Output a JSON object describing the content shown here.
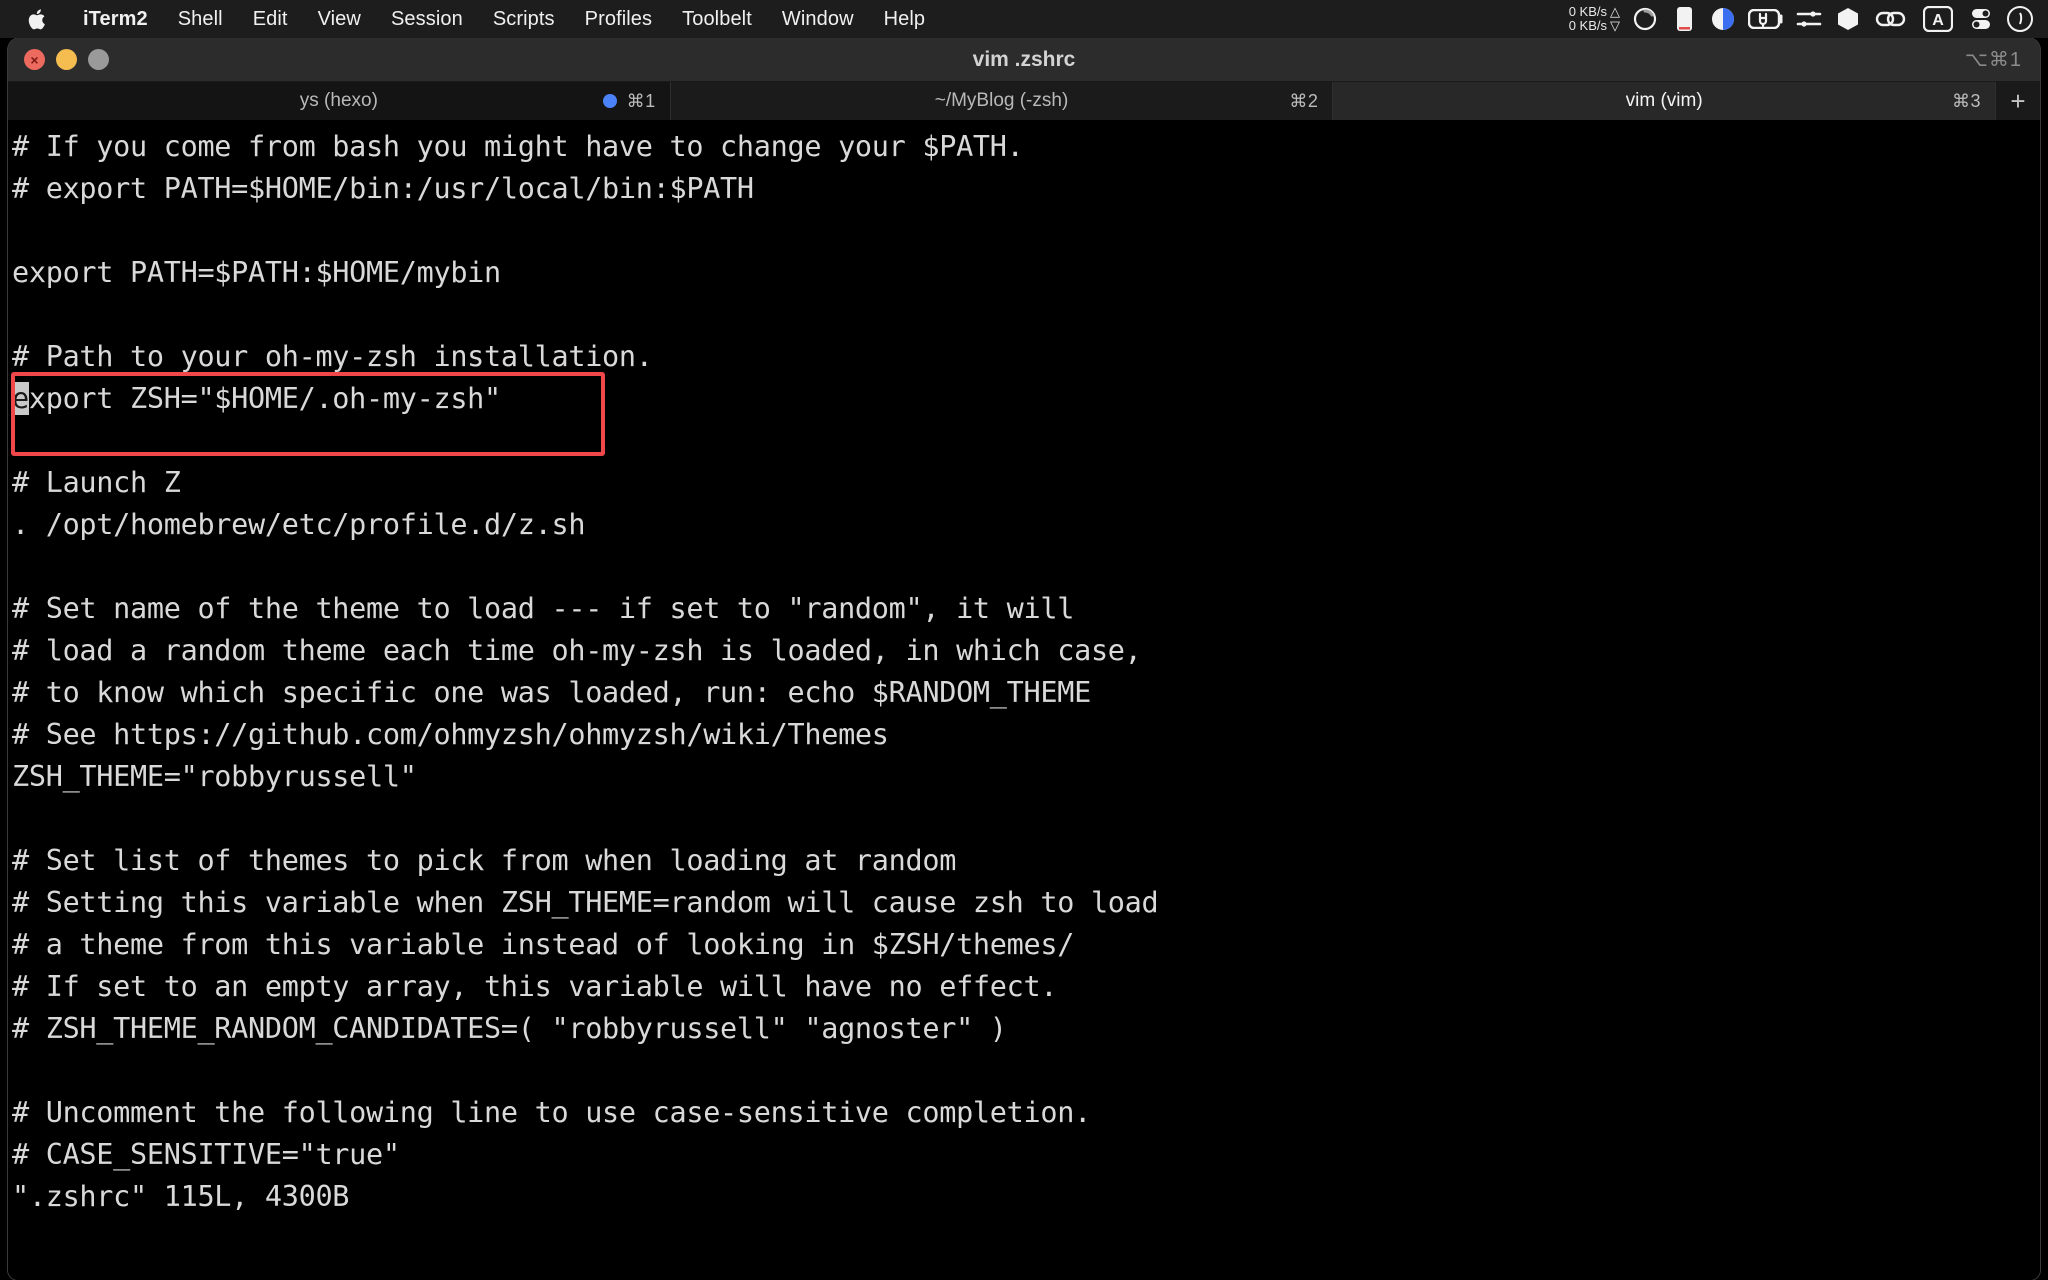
{
  "menubar": {
    "apple_icon": "apple-logo-icon",
    "items": [
      "iTerm2",
      "Shell",
      "Edit",
      "View",
      "Session",
      "Scripts",
      "Profiles",
      "Toolbelt",
      "Window",
      "Help"
    ],
    "status": {
      "upload_speed": "0 KB/s",
      "download_speed": "0 KB/s",
      "upload_arrow": "△",
      "download_arrow": "▽",
      "icons": [
        "activity-monitor-icon",
        "display-brightness-icon",
        "battery-charging-icon",
        "control-sliders-icon",
        "dropbox-icon",
        "link-icon",
        "input-method-a-icon",
        "toggle-switch-icon",
        "control-center-icon"
      ]
    }
  },
  "window": {
    "title": "vim .zshrc",
    "shortcut": "⌥⌘1",
    "traffic_lights": {
      "close": "close-button",
      "minimize": "minimize-button",
      "maximize": "maximize-button",
      "close_glyph": "×"
    }
  },
  "tabs": [
    {
      "label": "ys (hexo)",
      "shortcut": "⌘1",
      "active": false,
      "has_dot": true,
      "state": "normal"
    },
    {
      "label": "~/MyBlog (-zsh)",
      "shortcut": "⌘2",
      "active": false,
      "has_dot": false,
      "state": "semi"
    },
    {
      "label": "vim (vim)",
      "shortcut": "⌘3",
      "active": true,
      "has_dot": false,
      "state": "active"
    }
  ],
  "new_tab_button": "+",
  "terminal": {
    "lines": [
      "# If you come from bash you might have to change your $PATH.",
      "# export PATH=$HOME/bin:/usr/local/bin:$PATH",
      "",
      "export PATH=$PATH:$HOME/mybin",
      "",
      "# Path to your oh-my-zsh installation.",
      "export ZSH=\"$HOME/.oh-my-zsh\"",
      "",
      "# Launch Z",
      ". /opt/homebrew/etc/profile.d/z.sh",
      "",
      "# Set name of the theme to load --- if set to \"random\", it will",
      "# load a random theme each time oh-my-zsh is loaded, in which case,",
      "# to know which specific one was loaded, run: echo $RANDOM_THEME",
      "# See https://github.com/ohmyzsh/ohmyzsh/wiki/Themes",
      "ZSH_THEME=\"robbyrussell\"",
      "",
      "# Set list of themes to pick from when loading at random",
      "# Setting this variable when ZSH_THEME=random will cause zsh to load",
      "# a theme from this variable instead of looking in $ZSH/themes/",
      "# If set to an empty array, this variable will have no effect.",
      "# ZSH_THEME_RANDOM_CANDIDATES=( \"robbyrussell\" \"agnoster\" )",
      "",
      "# Uncomment the following line to use case-sensitive completion.",
      "# CASE_SENSITIVE=\"true\"",
      "\".zshrc\" 115L, 4300B"
    ],
    "cursor": {
      "line_index": 6,
      "column": 0,
      "character": "e"
    },
    "annotation": {
      "color": "#f0474b",
      "highlighted_lines": [
        "# Launch Z",
        ". /opt/homebrew/etc/profile.d/z.sh"
      ]
    }
  }
}
